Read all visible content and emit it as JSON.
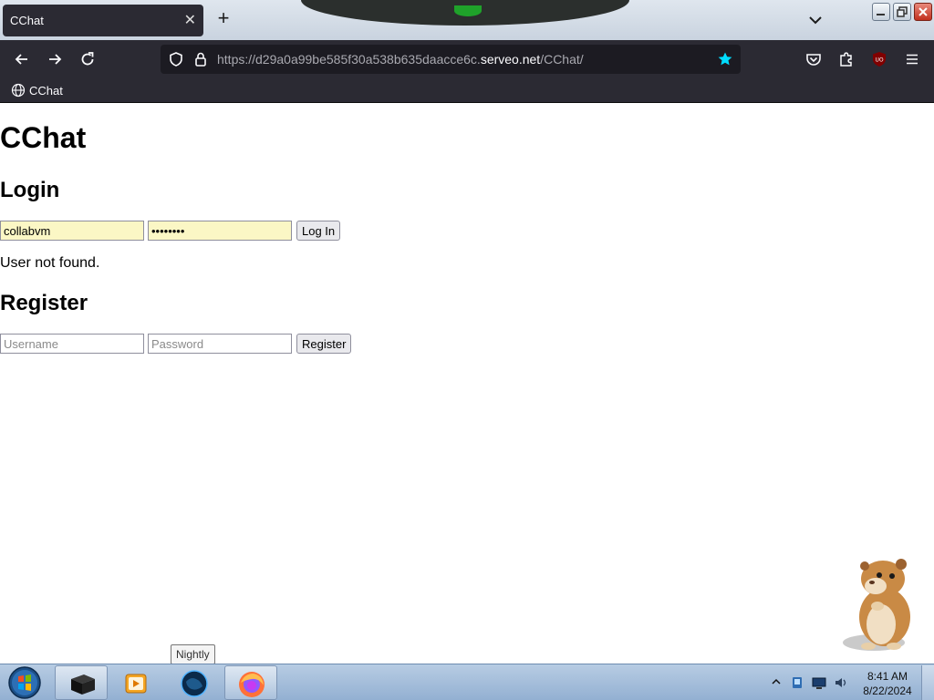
{
  "browser": {
    "tab_title": "CChat",
    "tab_close_glyph": "✕",
    "new_tab_glyph": "+",
    "url_prefix": "https://d29a0a99be585f30a538b635daacce6c.",
    "url_host": "serveo.net",
    "url_path": "/CChat/",
    "bookmark_label": "CChat",
    "accent": "#2b2a33"
  },
  "page": {
    "title": "CChat",
    "login": {
      "heading": "Login",
      "username_value": "collabvm",
      "password_value": "password",
      "button_label": "Log In",
      "status": "User not found."
    },
    "register": {
      "heading": "Register",
      "username_placeholder": "Username",
      "password_placeholder": "Password",
      "button_label": "Register"
    }
  },
  "taskbar": {
    "tooltip": "Nightly",
    "time": "8:41 AM",
    "date": "8/22/2024"
  },
  "icons": {
    "back": "arrow-left-icon",
    "forward": "arrow-right-icon",
    "reload": "reload-icon",
    "tracking": "shield-icon",
    "lock": "lock-icon",
    "bookmark_star": "star-icon",
    "pocket": "pocket-icon",
    "extensions": "puzzle-icon",
    "ublock": "ublock-icon",
    "menu": "hamburger-menu-icon"
  }
}
